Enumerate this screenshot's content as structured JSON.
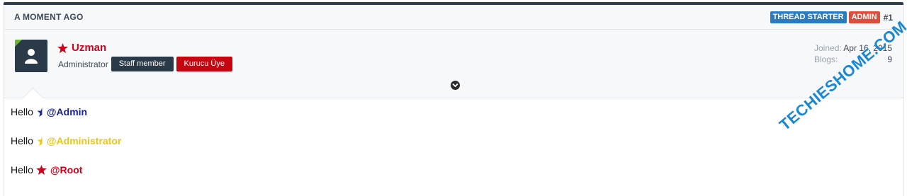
{
  "post": {
    "time": "A MOMENT AGO",
    "badges": {
      "starter": "THREAD STARTER",
      "admin": "ADMIN",
      "number": "#1"
    }
  },
  "user": {
    "name": "Uzman",
    "title": "Administrator",
    "banners": {
      "staff": "Staff member",
      "kurucu": "Kurucu Üye"
    },
    "stats": [
      {
        "label": "Joined:",
        "value": "Apr 16, 2015"
      },
      {
        "label": "Blogs:",
        "value": "9"
      }
    ]
  },
  "message": {
    "lines": [
      {
        "text": "Hello",
        "mention": "@Admin",
        "icon": "half-star-navy-icon",
        "color": "#1a2393"
      },
      {
        "text": "Hello",
        "mention": "@Administrator",
        "icon": "half-star-gold-icon",
        "color": "#f1c40f"
      },
      {
        "text": "Hello",
        "mention": "@Root",
        "icon": "star-red-icon",
        "color": "#d0021b"
      }
    ]
  },
  "watermark": "TECHIESHOME.COM",
  "colors": {
    "accent": "#2f3e4e",
    "admin_red": "#d0021b",
    "starter_blue": "#2a7bc0"
  }
}
